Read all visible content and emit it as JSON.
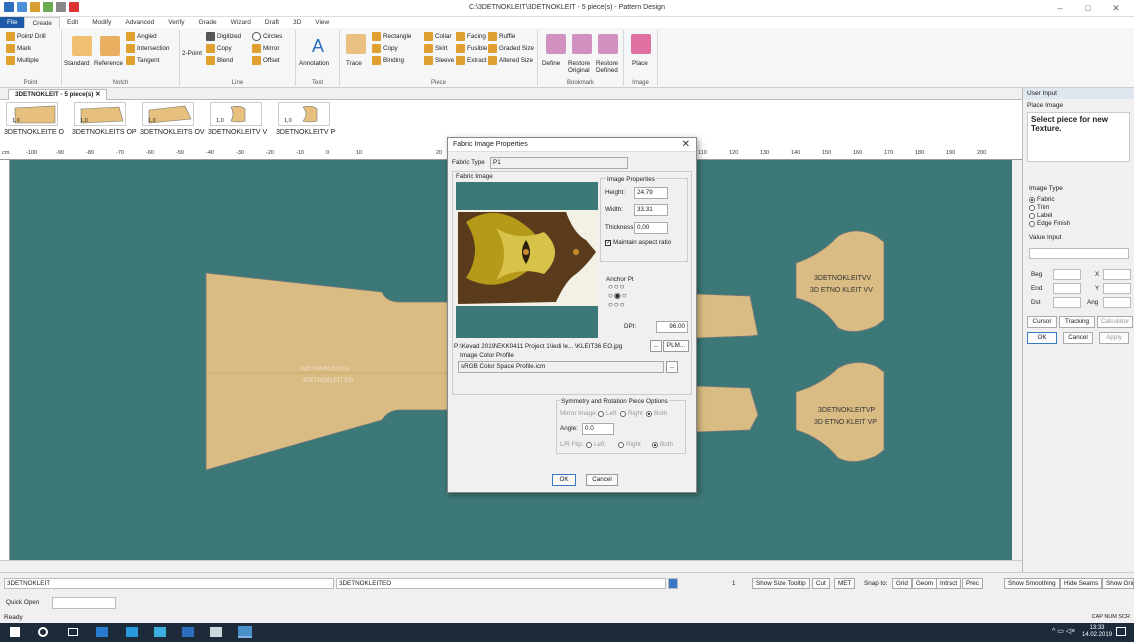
{
  "window": {
    "title": "C:\\3DETNOKLEIT\\3DETNOKLEIT - 5 piece(s) - Pattern Design"
  },
  "menu_tabs": [
    "File",
    "Create",
    "Edit",
    "Modify",
    "Advanced",
    "Verify",
    "Grade",
    "Wizard",
    "Draft",
    "3D",
    "View"
  ],
  "ribbon": {
    "point": {
      "label": "Point",
      "items": [
        "Point/ Drill",
        "Mark",
        "Multiple"
      ]
    },
    "notch": {
      "label": "Notch",
      "items": [
        "Angled",
        "Intersection",
        "Tangent"
      ],
      "standard": "Standard",
      "reference": "Reference"
    },
    "line": {
      "label": "Line",
      "items": [
        "Digitized",
        "Circles",
        "Copy",
        "Mirror",
        "Blend",
        "Offset"
      ],
      "two_point": "2-Point"
    },
    "text": {
      "label": "Text",
      "annotation": "Annotation"
    },
    "piece": {
      "label": "Piece",
      "trace": "Trace",
      "items": [
        "Rectangle",
        "Collar",
        "Facing",
        "Ruffle",
        "Copy",
        "Skirt",
        "Fusible",
        "Graded Size",
        "Binding",
        "Sleeve",
        "Extract",
        "Altered Size"
      ]
    },
    "bookmark": {
      "label": "Bookmark",
      "items": [
        "Define",
        "Restore Original",
        "Restore Defined"
      ]
    },
    "image": {
      "label": "Image",
      "place": "Place"
    }
  },
  "doc_tab": {
    "label": "3DETNOKLEIT - 5 piece(s)"
  },
  "thumbs": [
    {
      "count": "1,0",
      "name": "3DETNOKLEITE O"
    },
    {
      "count": "1,0",
      "name": "3DETNOKLEITS OP"
    },
    {
      "count": "1,0",
      "name": "3DETNOKLEITS OV"
    },
    {
      "count": "1,0",
      "name": "3DETNOKLEITV V"
    },
    {
      "count": "1,0",
      "name": "3DETNOKLEITV P"
    }
  ],
  "ruler": {
    "unit": "cm.",
    "top_ticks": [
      "-100",
      "-90",
      "-80",
      "-70",
      "-60",
      "-50",
      "-40",
      "-30",
      "-20",
      "-10",
      "0",
      "10",
      "20",
      "110",
      "120",
      "130",
      "140",
      "150",
      "160",
      "170",
      "180",
      "190",
      "200"
    ]
  },
  "canvas_labels": {
    "left_piece": [
      "3DETNOKLEITEO",
      "3DETNOKLEIT EO"
    ],
    "right_top": [
      "3DETNOKLEITVV",
      "3D ETNO KLEIT VV"
    ],
    "right_bottom": [
      "3DETNOKLEITVP",
      "3D ETNO KLEIT VP"
    ]
  },
  "right_panel": {
    "title": "User Input",
    "subtitle": "Place Image",
    "prompt": "Select piece for new Texture.",
    "image_type_label": "Image Type",
    "image_types": [
      {
        "label": "Fabric",
        "selected": true
      },
      {
        "label": "Trim",
        "selected": false
      },
      {
        "label": "Label",
        "selected": false
      },
      {
        "label": "Edge Finish",
        "selected": false
      }
    ],
    "value_input": "Value Input",
    "fields": {
      "beg": "Beg",
      "end": "End",
      "dst": "Dst",
      "x": "X",
      "y": "Y",
      "ang": "Ang"
    },
    "buttons": {
      "cursor": "Cursor",
      "tracking": "Tracking",
      "calculator": "Calculator",
      "ok": "OK",
      "cancel": "Cancel",
      "apply": "Apply"
    }
  },
  "dialog": {
    "title": "Fabric Image Properties",
    "fabric_type_label": "Fabric Type",
    "fabric_type_value": "P1",
    "fabric_image_label": "Fabric Image",
    "image_properties_label": "Image Properties",
    "height_label": "Height:",
    "height_value": "24.79",
    "width_label": "Width:",
    "width_value": "33.31",
    "thickness_label": "Thickness:",
    "thickness_value": "0.00",
    "maintain_aspect": "Maintain aspect ratio",
    "anchor_label": "Anchor Pt",
    "dpi_label": "DPI:",
    "dpi_value": "96.00",
    "path": "P:\\Kevad 2019\\EKK0411 Project 1\\ledi le... \\KLEIT36 EO.jpg",
    "browse": "...",
    "plm": "PLM...",
    "color_profile_label": "Image Color Profile",
    "color_profile_value": "sRGB Color Space Profile.icm",
    "sym_label": "Symmetry and Rotation Piece Options",
    "mirror_label": "Mirror Image:",
    "left": "Left",
    "right": "Right",
    "both": "Both",
    "angle_label": "Angle:",
    "angle_value": "0.0",
    "lr_flip_label": "L/R Flip:",
    "ok": "OK",
    "cancel": "Cancel"
  },
  "status": {
    "left_box": "3DETNOKLEIT",
    "mid_box": "3DETNOKLEITEO",
    "page_num": "1",
    "buttons": [
      "Show Size Tooltip",
      "Cut",
      "MET",
      "Snap to:",
      "Grid",
      "Geom",
      "Intrsct",
      "Prec"
    ],
    "right_buttons": [
      "Show Smoothing",
      "Hide Seams",
      "Show Grid"
    ]
  },
  "quick_open_label": "Quick Open",
  "ready_text": "Ready",
  "tray": {
    "caps": "CAP NUM SCR",
    "time": "13:33",
    "date": "14.02.2019"
  }
}
